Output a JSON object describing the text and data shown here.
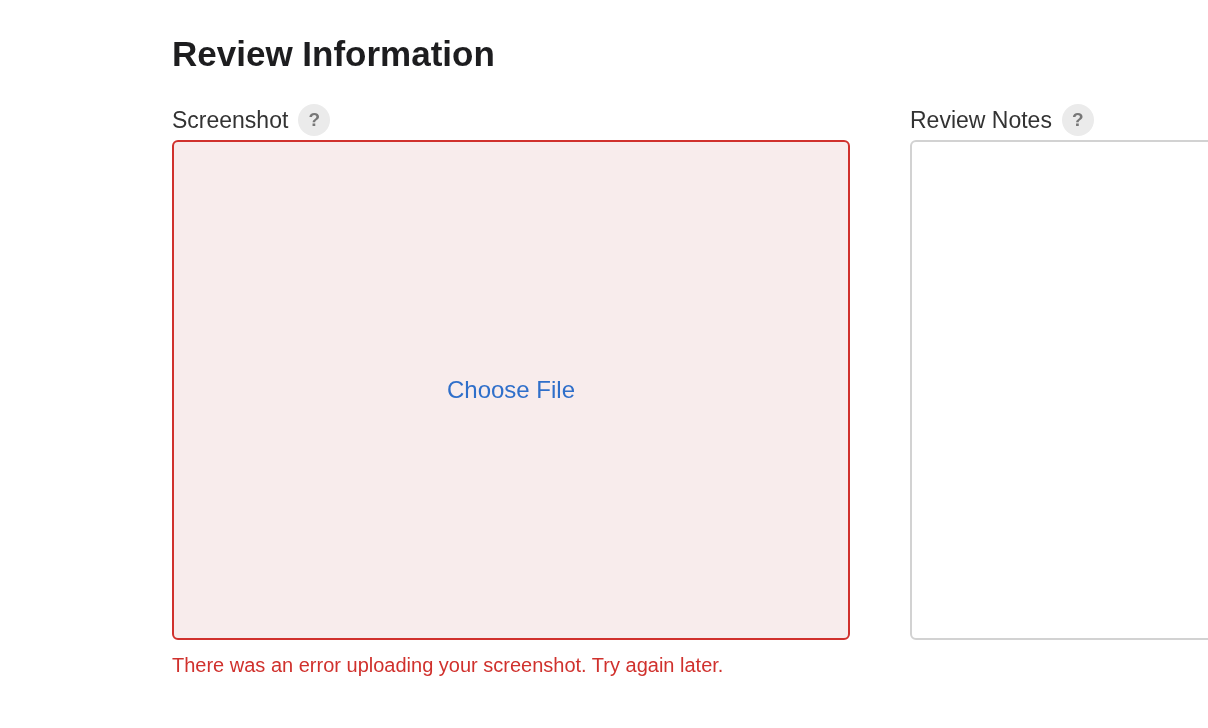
{
  "heading": "Review Information",
  "screenshot": {
    "label": "Screenshot",
    "help": "?",
    "error": true,
    "button": "Choose File",
    "error_message": "There was an error uploading your screenshot. Try again later."
  },
  "notes": {
    "label": "Review Notes",
    "help": "?"
  }
}
